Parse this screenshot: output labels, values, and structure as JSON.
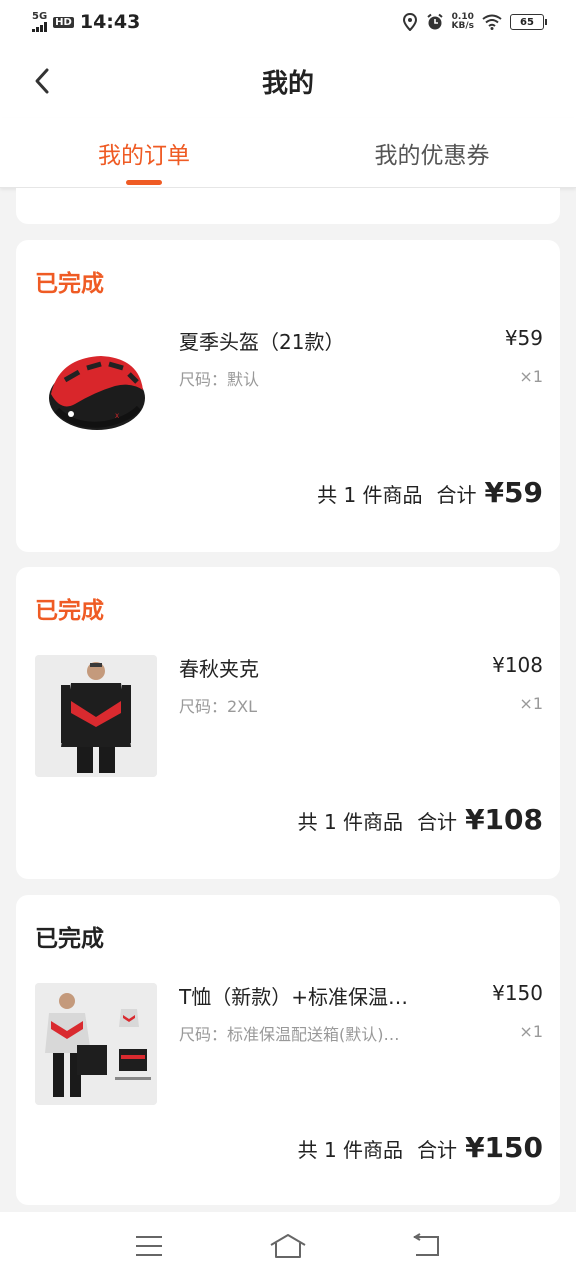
{
  "status_bar": {
    "network": "5G",
    "hd": "HD",
    "time": "14:43",
    "speed_value": "0.10",
    "speed_unit": "KB/s",
    "battery": "65"
  },
  "header": {
    "title": "我的"
  },
  "tabs": [
    {
      "label": "我的订单",
      "active": true
    },
    {
      "label": "我的优惠券",
      "active": false
    }
  ],
  "orders": [
    {
      "status": "已完成",
      "status_color": "#ef5b24",
      "product_name": "夏季头盔（21款）",
      "price": "¥59",
      "spec": "尺码：默认",
      "qty": "×1",
      "count_text": "共 1 件商品",
      "total_label": "合计",
      "total": "¥59",
      "image_icon": "helmet-image"
    },
    {
      "status": "已完成",
      "status_color": "#ef5b24",
      "product_name": "春秋夹克",
      "price": "¥108",
      "spec": "尺码：2XL",
      "qty": "×1",
      "count_text": "共 1 件商品",
      "total_label": "合计",
      "total": "¥108",
      "image_icon": "jacket-image"
    },
    {
      "status": "已完成",
      "status_color": "#222222",
      "product_name": "T恤（新款）+标准保温…",
      "price": "¥150",
      "spec": "尺码：标准保温配送箱(默认)…",
      "qty": "×1",
      "count_text": "共 1 件商品",
      "total_label": "合计",
      "total": "¥150",
      "image_icon": "tshirt-box-image"
    }
  ],
  "colors": {
    "accent": "#ef5b24",
    "background": "#f3f3f3"
  },
  "bottom_nav": {
    "icons": [
      "menu-icon",
      "home-icon",
      "back-icon"
    ]
  }
}
